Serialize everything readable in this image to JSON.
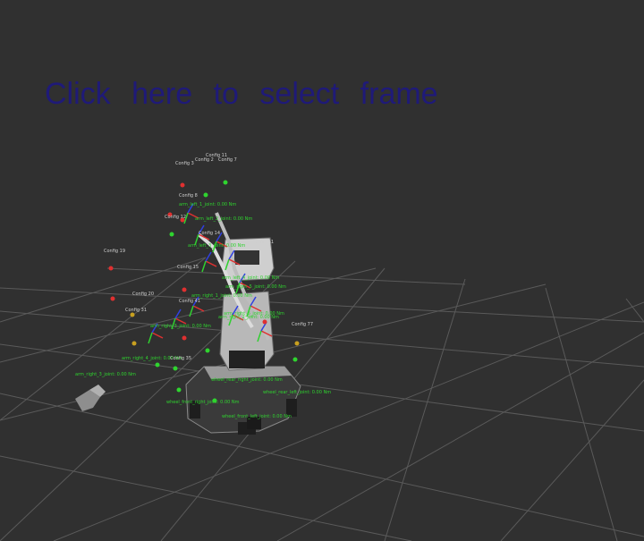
{
  "prompt": {
    "text": "Click here to select frame"
  },
  "colors": {
    "background": "#303030",
    "grid": "#5a5a5a",
    "prompt_text": "#1f1a78",
    "tf_label_green": "#2fd42f",
    "frame_label_grey": "#cfcfcf",
    "axis_x": "#e03030",
    "axis_y": "#30d030",
    "axis_z": "#3040e0"
  },
  "tf_labels": [
    "arm_left_1_joint: 0.00 Nm",
    "arm_left_2_joint: 0.00 Nm",
    "arm_left_3_joint: 0.00 Nm",
    "arm_left_4_joint: 0.00 Nm",
    "arm_right_1_joint: 0.00 Nm",
    "arm_right_2_joint: 0.00 Nm",
    "arm_right_3_joint: 0.00 Nm",
    "arm_right_4_joint: 0.00 Nm",
    "arm_right_5_joint: 0.00 Nm",
    "arm_right_6_joint: 0.00 Nm",
    "wheel_rear_right_joint: 0.00 Nm",
    "wheel_rear_left_joint: 0.00 Nm",
    "wheel_front_right_joint: 0.00 Nm",
    "wheel_front_left_joint: 0.00 Nm"
  ],
  "frame_labels": [
    "Config 3",
    "Config 2",
    "Config 11",
    "Config 7",
    "Config 8",
    "Config 12",
    "Config 14",
    "Config 15",
    "Config 19",
    "Config 20",
    "Config 31",
    "Config 41",
    "Config 35",
    "Config 51",
    "Config 77"
  ]
}
